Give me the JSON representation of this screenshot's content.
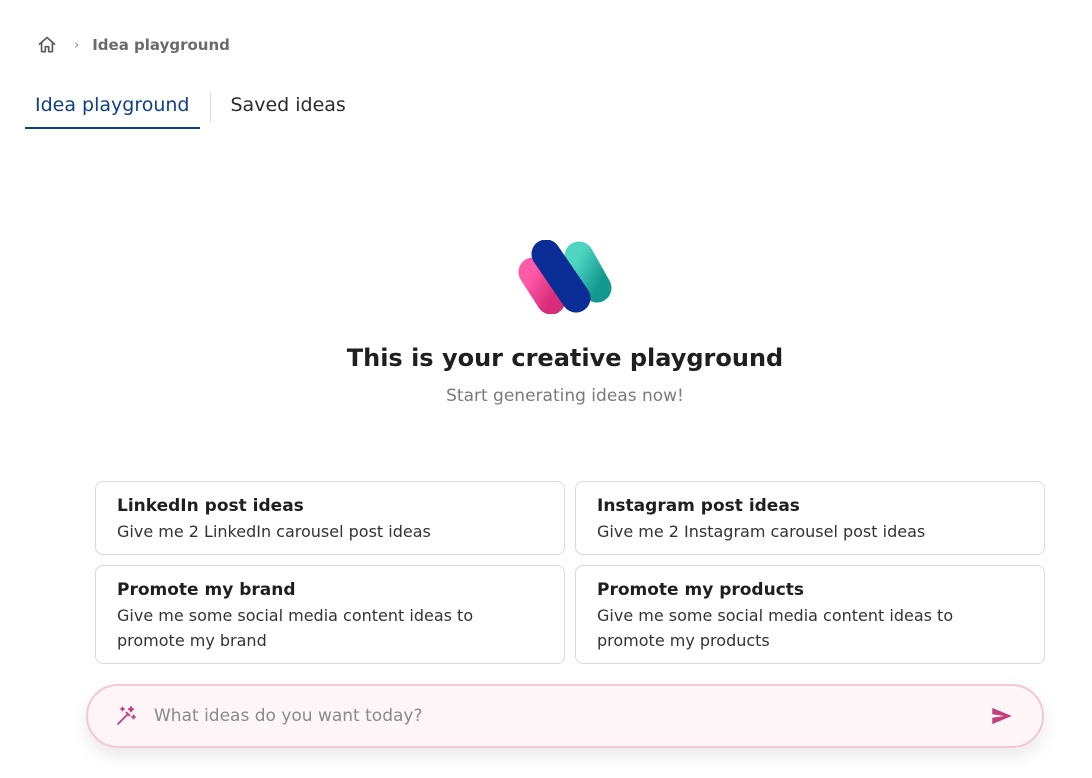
{
  "breadcrumb": {
    "separator": "›",
    "current": "Idea playground"
  },
  "tabs": [
    {
      "label": "Idea playground",
      "active": true
    },
    {
      "label": "Saved ideas",
      "active": false
    }
  ],
  "hero": {
    "title": "This is your creative playground",
    "subtitle": "Start generating ideas now!"
  },
  "cards": [
    {
      "title": "LinkedIn post ideas",
      "description": "Give me 2 LinkedIn carousel post ideas"
    },
    {
      "title": "Instagram post ideas",
      "description": "Give me 2 Instagram carousel post ideas"
    },
    {
      "title": "Promote my brand",
      "description": "Give me some social media content ideas to promote my brand"
    },
    {
      "title": "Promote my products",
      "description": "Give me some social media content ideas to promote my products"
    }
  ],
  "prompt": {
    "placeholder": "What ideas do you want today?"
  },
  "icons": {
    "home": "home-icon",
    "wand": "magic-wand-icon",
    "send": "send-icon"
  },
  "colors": {
    "accent": "#0f3f8a",
    "pink": "#c2407a",
    "teal": "#2bb5a5"
  }
}
